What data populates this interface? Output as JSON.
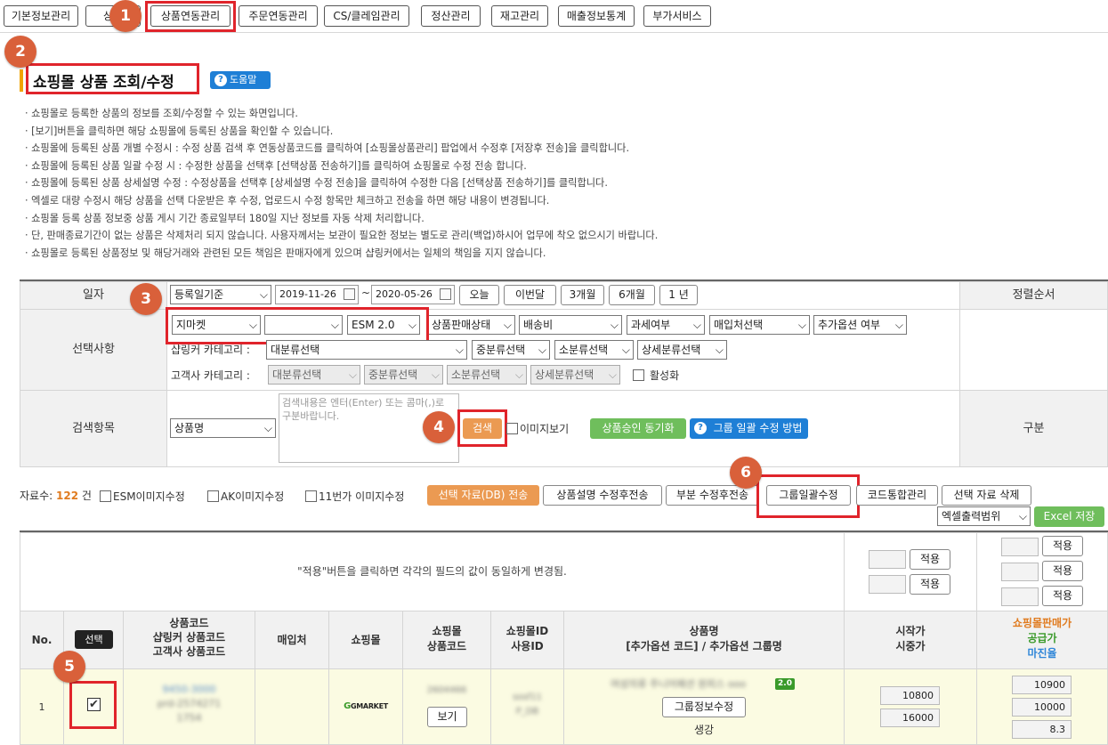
{
  "top_nav": {
    "items": [
      "기본정보관리",
      "상품",
      "상품연동관리",
      "주문연동관리",
      "CS/클레임관리",
      "정산관리",
      "재고관리",
      "매출정보통계",
      "부가서비스"
    ]
  },
  "page": {
    "title": "쇼핑몰 상품 조회/수정",
    "help_label": "도움말",
    "notices": [
      "· 쇼핑몰로 등록한 상품의 정보를 조회/수정할 수 있는 화면입니다.",
      "· [보기]버튼을 클릭하면 해당 쇼핑몰에 등록된 상품을 확인할 수 있습니다.",
      "· 쇼핑몰에 등록된 상품 개별 수정시 : 수정 상품 검색 후 연동상품코드를 클릭하여 [쇼핑몰상품관리] 팝업에서 수정후 [저장후 전송]을 클릭합니다.",
      "· 쇼핑몰에 등록된 상품 일괄 수정 시 : 수정한 상품을 선택후 [선택상품 전송하기]를 클릭하여 쇼핑몰로 수정 전송 합니다.",
      "· 쇼핑몰에 등록된 상품 상세설명 수정 : 수정상품을 선택후 [상세설명 수정 전송]을 클릭하여 수정한 다음 [선택상품 전송하기]를 클릭합니다.",
      "· 엑셀로 대량 수정시 해당 상품을 선택 다운받은 후 수정, 업로드시 수정 항목만 체크하고 전송을 하면 해당 내용이 변경됩니다.",
      "· 쇼핑몰 등록 상품 정보중 상품 게시 기간 종료일부터 180일 지난 정보를 자동 삭제 처리합니다.",
      "· 단, 판매종료기간이 없는 상품은 삭제처리 되지 않습니다. 사용자께서는 보관이 필요한 정보는 별도로 관리(백업)하시어 업무에 착오 없으시기 바랍니다.",
      "· 쇼핑몰로 등록된 상품정보 및 해당거래와 관련된 모든 책임은 판매자에게 있으며 샵링커에서는 일체의 책임을 지지 않습니다."
    ]
  },
  "badges": [
    "1",
    "2",
    "3",
    "4",
    "5",
    "6"
  ],
  "search": {
    "date_label": "일자",
    "date_type": "등록일기준",
    "date_from": "2019-11-26",
    "date_tilde": "~",
    "date_to": "2020-05-26",
    "quick_dates": [
      "오늘",
      "이번달",
      "3개월",
      "6개월",
      "1 년"
    ],
    "sort_label": "정렬순서",
    "select_label": "선택사항",
    "mall": "지마켓",
    "mall_sub": "",
    "esm": "ESM 2.0",
    "filters": [
      "상품판매상태",
      "배송비",
      "과세여부",
      "매입처선택",
      "추가옵션 여부"
    ],
    "shoplinker_cat_label": "샵링커 카테고리 :",
    "shoplinker_cats": [
      "대분류선택",
      "중분류선택",
      "소분류선택",
      "상세분류선택"
    ],
    "customer_cat_label": "고객사 카테고리 :",
    "customer_cats": [
      "대분류선택",
      "중분류선택",
      "소분류선택",
      "상세분류선택"
    ],
    "activate_label": "활성화",
    "search_item_label": "검색항목",
    "search_field": "상품명",
    "search_placeholder": "검색내용은 엔터(Enter) 또는 콤마(,)로 구분바랍니다.",
    "search_button": "검색",
    "image_view_label": "이미지보기",
    "sync_button": "상품승인 동기화",
    "group_help_button": "그룹 일괄 수정 방법",
    "division_label": "구분"
  },
  "toolbar": {
    "count_label": "자료수:",
    "count_value": "122",
    "count_unit": "건",
    "esm_image": "ESM이미지수정",
    "ak_image": "AK이미지수정",
    "st11_image": "11번가 이미지수정",
    "send_selected": "선택 자료(DB) 전송",
    "desc_send": "상품설명 수정후전송",
    "partial_send": "부분 수정후전송",
    "group_edit": "그룹일괄수정",
    "code_merge": "코드통합관리",
    "delete_selected": "선택 자료 삭제",
    "excel_range": "엑셀출력범위",
    "excel_save": "Excel 저장"
  },
  "bulk": {
    "notice": "\"적용\"버튼을 클릭하면 각각의 필드의 값이 동일하게 변경됨.",
    "apply_label": "적용"
  },
  "table": {
    "headers": {
      "no": "No.",
      "select": "선택",
      "code_lines": [
        "상품코드",
        "샵링커 상품코드",
        "고객사 상품코드"
      ],
      "supplier": "매입처",
      "mall": "쇼핑몰",
      "mall_code_lines": [
        "쇼핑몰",
        "상품코드"
      ],
      "mall_id_lines": [
        "쇼핑몰ID",
        "사용ID"
      ],
      "name_lines": [
        "상품명",
        "[추가옵션 코드] / 추가옵션 그룹명"
      ],
      "price_lines": [
        "시작가",
        "시중가"
      ],
      "sale_price": "쇼핑몰판매가",
      "supply_price": "공급가",
      "margin": "마진율"
    },
    "row": {
      "no": "1",
      "codes": [
        "9450-3000",
        "prd-2574271",
        "1754"
      ],
      "mall_logo": "GMARKET",
      "mall_code": "2604466",
      "view_button": "보기",
      "mall_id": [
        "sosf11",
        "P_DB"
      ],
      "name": "여성의류 주니어패션 원피스 ooo",
      "esm_tag": "2.0",
      "group_info_button": "그룹정보수정",
      "option_name": "생강",
      "start_price": "10800",
      "market_price": "16000",
      "sale_price": "10900",
      "supply_price": "10000",
      "margin": "8.3"
    }
  },
  "colors": {
    "accent_red": "#e0242b",
    "badge": "#d9603a",
    "orange_btn": "#eb9a52",
    "green_btn": "#6fbe5c",
    "blue_btn": "#1e7fd6",
    "title_bar": "#f0a500"
  }
}
